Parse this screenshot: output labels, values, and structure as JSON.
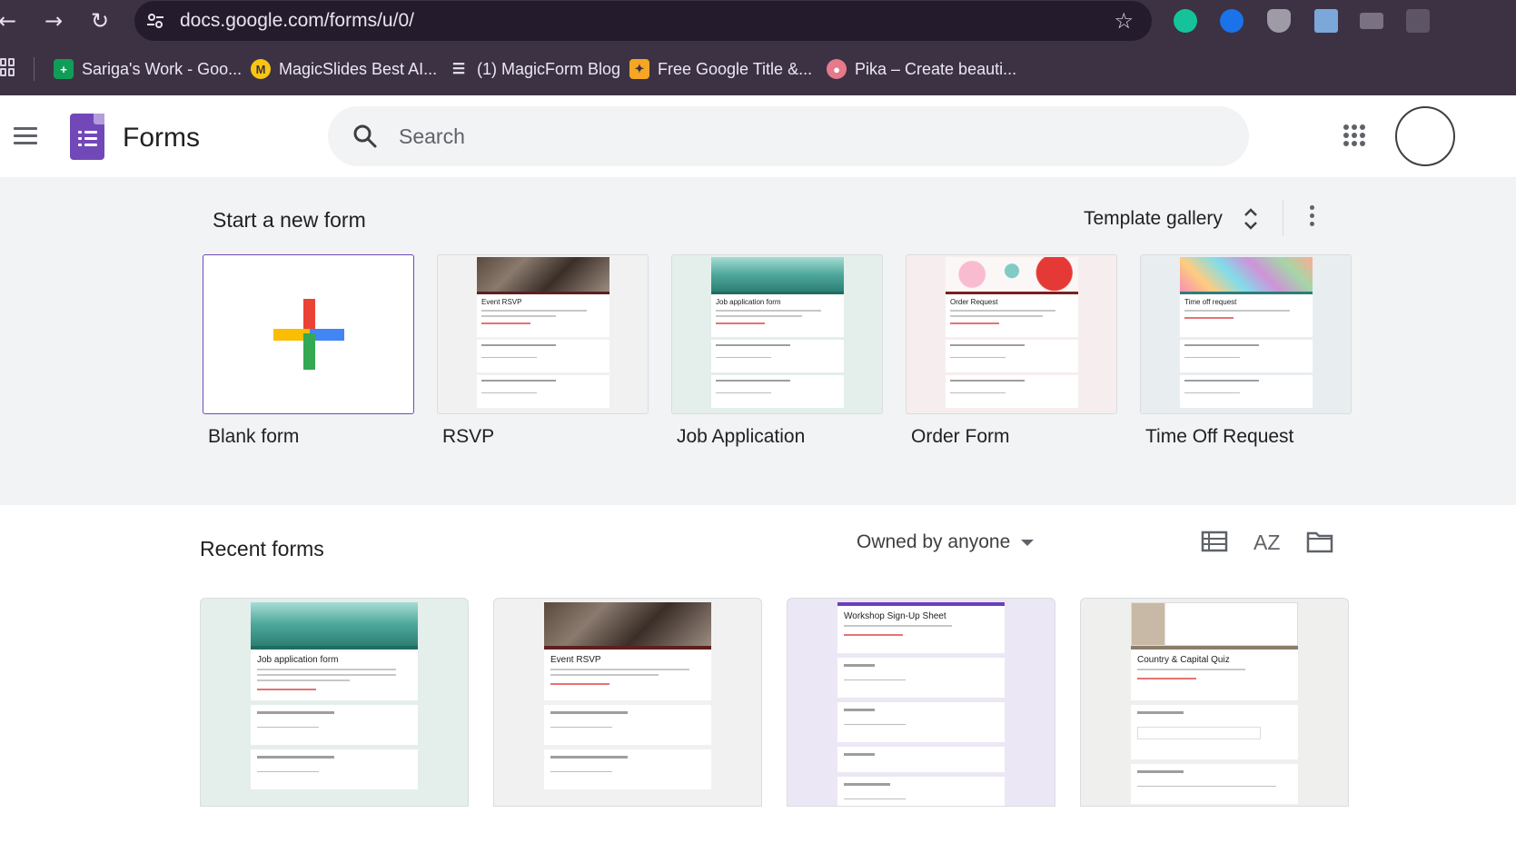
{
  "browser": {
    "url": "docs.google.com/forms/u/0/",
    "bookmarks": [
      {
        "label": "Sariga's Work - Goo...",
        "icon": "sheets-icon",
        "color": "#0f9d58"
      },
      {
        "label": "MagicSlides Best AI...",
        "icon": "magicslides-icon",
        "color": "#f9c513"
      },
      {
        "label": "(1) MagicForm Blog",
        "icon": "list-icon",
        "color": "#3c3244"
      },
      {
        "label": "Free Google Title &...",
        "icon": "arrows-icon",
        "color": "#f5a623"
      },
      {
        "label": "Pika – Create beauti...",
        "icon": "pika-icon",
        "color": "#e57a8a"
      }
    ]
  },
  "app": {
    "title": "Forms",
    "search_placeholder": "Search"
  },
  "start": {
    "title": "Start a new form",
    "gallery_label": "Template gallery",
    "templates": [
      {
        "label": "Blank form"
      },
      {
        "label": "RSVP",
        "mini_title": "Event RSVP"
      },
      {
        "label": "Job Application",
        "mini_title": "Job application form"
      },
      {
        "label": "Order Form",
        "mini_title": "Order Request"
      },
      {
        "label": "Time Off Request",
        "mini_title": "Time off request"
      }
    ]
  },
  "recent": {
    "title": "Recent forms",
    "owner_filter": "Owned by anyone",
    "sort_label": "AZ",
    "forms": [
      {
        "title": "Job application form"
      },
      {
        "title": "Event RSVP"
      },
      {
        "title": "Workshop Sign-Up Sheet"
      },
      {
        "title": "Country & Capital Quiz"
      }
    ]
  },
  "colors": {
    "brand": "#7248b9",
    "chrome": "#3c3244"
  }
}
